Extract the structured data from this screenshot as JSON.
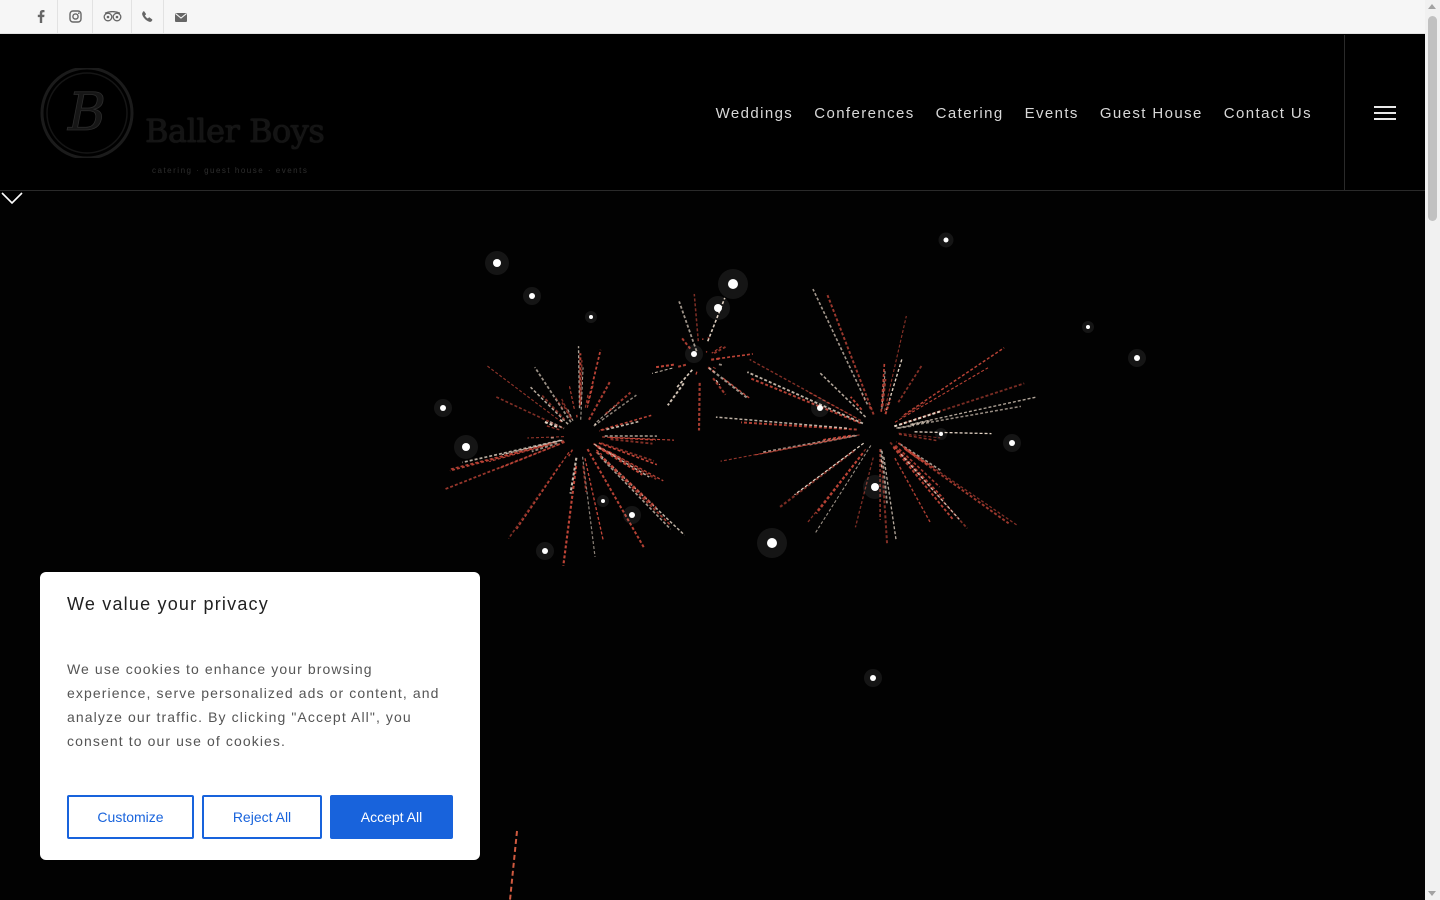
{
  "topbar": {
    "icons": [
      "facebook-icon",
      "instagram-icon",
      "tripadvisor-icon",
      "phone-icon",
      "envelope-icon"
    ]
  },
  "header": {
    "logo_monogram": "B",
    "brand_name": "Baller Boys",
    "brand_tagline": "catering · guest house · events",
    "nav": [
      "Weddings",
      "Conferences",
      "Catering",
      "Events",
      "Guest House",
      "Contact Us"
    ]
  },
  "cookie_banner": {
    "title": "We value your privacy",
    "body": "We use cookies to enhance your browsing experience, serve personalized ads or content, and analyze our traffic. By clicking \"Accept All\", you consent to our use of cookies.",
    "customize_label": "Customize",
    "reject_label": "Reject All",
    "accept_label": "Accept All",
    "accent_color": "#1863dc"
  }
}
